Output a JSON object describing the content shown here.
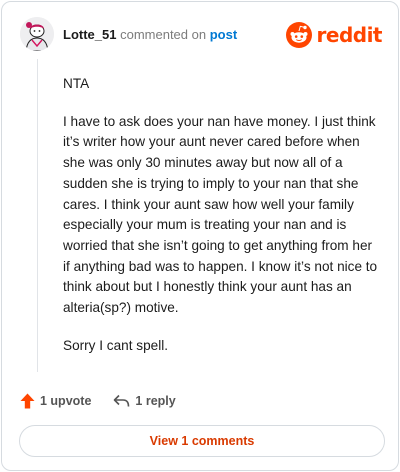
{
  "header": {
    "username": "Lotte_51",
    "action_text": "commented on",
    "post_link": "post",
    "brand": "reddit"
  },
  "comment": {
    "paragraphs": [
      "NTA",
      "I have to ask does your nan have money. I just think it’s writer how your aunt never cared before when she was only 30 minutes away but now all of a sudden she is trying to imply to your nan that she cares. I think your aunt saw how well your family especially your mum is treating your nan and is worried that she isn’t going to get anything from her if anything bad was to happen. I know it’s not nice to think about but I honestly think your aunt has an alteria(sp?) motive.",
      "Sorry I cant spell."
    ]
  },
  "actions": {
    "upvote_label": "1 upvote",
    "reply_label": "1 reply"
  },
  "footer": {
    "view_comments_label": "View 1 comments"
  },
  "colors": {
    "brand": "#ff4500",
    "upvote": "#ff4500",
    "link": "#0079d3",
    "view_button_text": "#d93a00"
  },
  "icons": [
    "avatar-icon",
    "reddit-logo-icon",
    "upvote-arrow-icon",
    "reply-arrow-icon"
  ]
}
